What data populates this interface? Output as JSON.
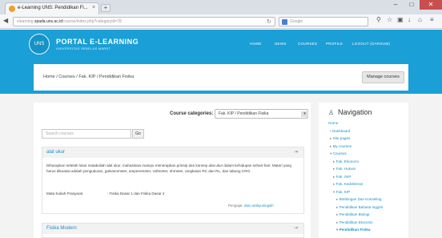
{
  "browser": {
    "tab_title": "e-Learning UNS: Pendidikan Fi...",
    "url_domain": "spada.uns.ac.id",
    "url_path": "/course/index.php?categoryid=78",
    "url_scheme": "elearning.",
    "search_placeholder": "Google",
    "win_min": "–",
    "win_max": "□",
    "win_close": "✕"
  },
  "header": {
    "logo_text": "UNS",
    "site_name": "PORTAL E-LEARNING",
    "site_sub": "UNIVERSITAS SEBELAS MARET",
    "menu": [
      "HOME",
      "NEWS",
      "COURSES",
      "PROFILE",
      "LOGOUT (DARSUM)"
    ]
  },
  "breadcrumb": {
    "text": "Home / Courses / Fak. KIP / Pendidikan Fisika",
    "manage_label": "Manage courses"
  },
  "main": {
    "category_label": "Course categories:",
    "category_value": "Fak. KIP / Pendidikan Fisika",
    "search_placeholder": "Search courses",
    "go_label": "Go",
    "courses": [
      {
        "title": "alat ukur",
        "description": "Diharapkan setelah lulus matakuliah alat ukur, mahasiswa mampu menerapkan prinsip dan konsep alat ukur dalam kehidupan sehari-hari.  Materi yang harus dikuasai adalah pengukuran, galvanometer, amperemeter, voltmeter, ohmeter, rangkaian RC dan RL, dan tabung CRO.",
        "prereq_label": "Mata Kuliah Prasyarat",
        "prereq_value": ": Fisika Dasar 1 dan Fisika Dasar 2",
        "teacher_label": "Pengajar:",
        "teacher_name": "daru wahyuningsih"
      },
      {
        "title": "Fisika Modern"
      }
    ]
  },
  "sidebar": {
    "title": "Navigation",
    "items": [
      {
        "text": "Home",
        "marker": ""
      },
      {
        "text": "Dashboard",
        "marker": "•"
      },
      {
        "text": "Site pages",
        "marker": "▸"
      },
      {
        "text": "My courses",
        "marker": "▸"
      },
      {
        "text": "Courses",
        "marker": "▾"
      },
      {
        "text": "Fak. Ekonomi",
        "marker": "▸"
      },
      {
        "text": "Fak. Hukum",
        "marker": "▸"
      },
      {
        "text": "Fak. ISIP",
        "marker": "▸"
      },
      {
        "text": "Fak. Kedokteran",
        "marker": "▸"
      },
      {
        "text": "Fak. KIP",
        "marker": "▾"
      },
      {
        "text": "Bimbingan Dan Konseling",
        "marker": "▸"
      },
      {
        "text": "Pendidikan Bahasa Inggris",
        "marker": "▸"
      },
      {
        "text": "Pendidikan Biologi",
        "marker": "▸"
      },
      {
        "text": "Pendidikan Ekonomi",
        "marker": "▸"
      },
      {
        "text": "Pendidikan Fisika",
        "marker": "▾"
      }
    ]
  },
  "colors": {
    "brand": "#1a9fd6",
    "link": "#1a8fc9"
  }
}
